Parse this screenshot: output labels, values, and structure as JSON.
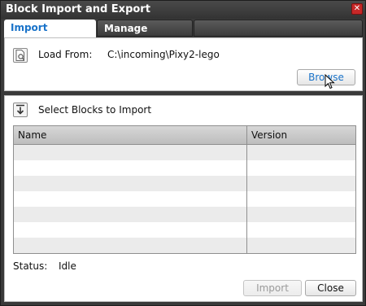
{
  "window": {
    "title": "Block Import and Export",
    "close_glyph": "✕"
  },
  "tabs": [
    {
      "label": "Import"
    },
    {
      "label": "Manage"
    }
  ],
  "load": {
    "label": "Load From:",
    "path": "C:\\incoming\\Pixy2-lego",
    "browse_label": "Browse"
  },
  "select": {
    "label": "Select Blocks to Import"
  },
  "table": {
    "columns": [
      "Name",
      "Version"
    ],
    "rows": []
  },
  "status": {
    "label": "Status:",
    "value": "Idle"
  },
  "buttons": {
    "import_label": "Import",
    "close_label": "Close"
  },
  "colors": {
    "accent": "#1a73c9",
    "title_bg": "#3a3a3a",
    "close_red": "#c62828"
  },
  "icons": {
    "load": "file-search-icon",
    "select": "download-arrow-icon",
    "close": "close-icon"
  }
}
